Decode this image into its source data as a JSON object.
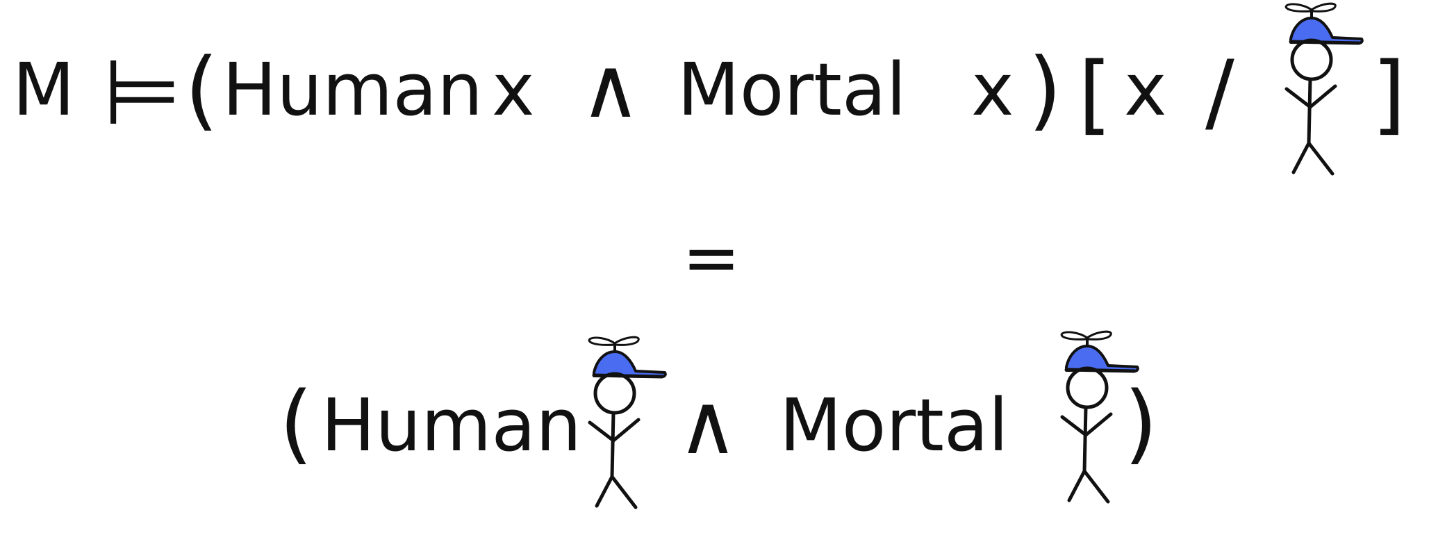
{
  "line1": {
    "model": "M",
    "entails": "⊨",
    "lparen": "(",
    "pred1": "Human",
    "var1": "x",
    "and": "∧",
    "pred2": "Mortal",
    "var2": "x",
    "rparen": ")",
    "lbracket": "[",
    "var3": "x",
    "slash": "/",
    "rbracket": "]"
  },
  "equals": "=",
  "line3": {
    "lparen": "(",
    "pred1": "Human",
    "and": "∧",
    "pred2": "Mortal",
    "rparen": ")"
  },
  "figure": {
    "description_icon": "stick-figure-propeller-cap-icon",
    "cap_color": "#4a6cf0",
    "ink_color": "#111111"
  }
}
